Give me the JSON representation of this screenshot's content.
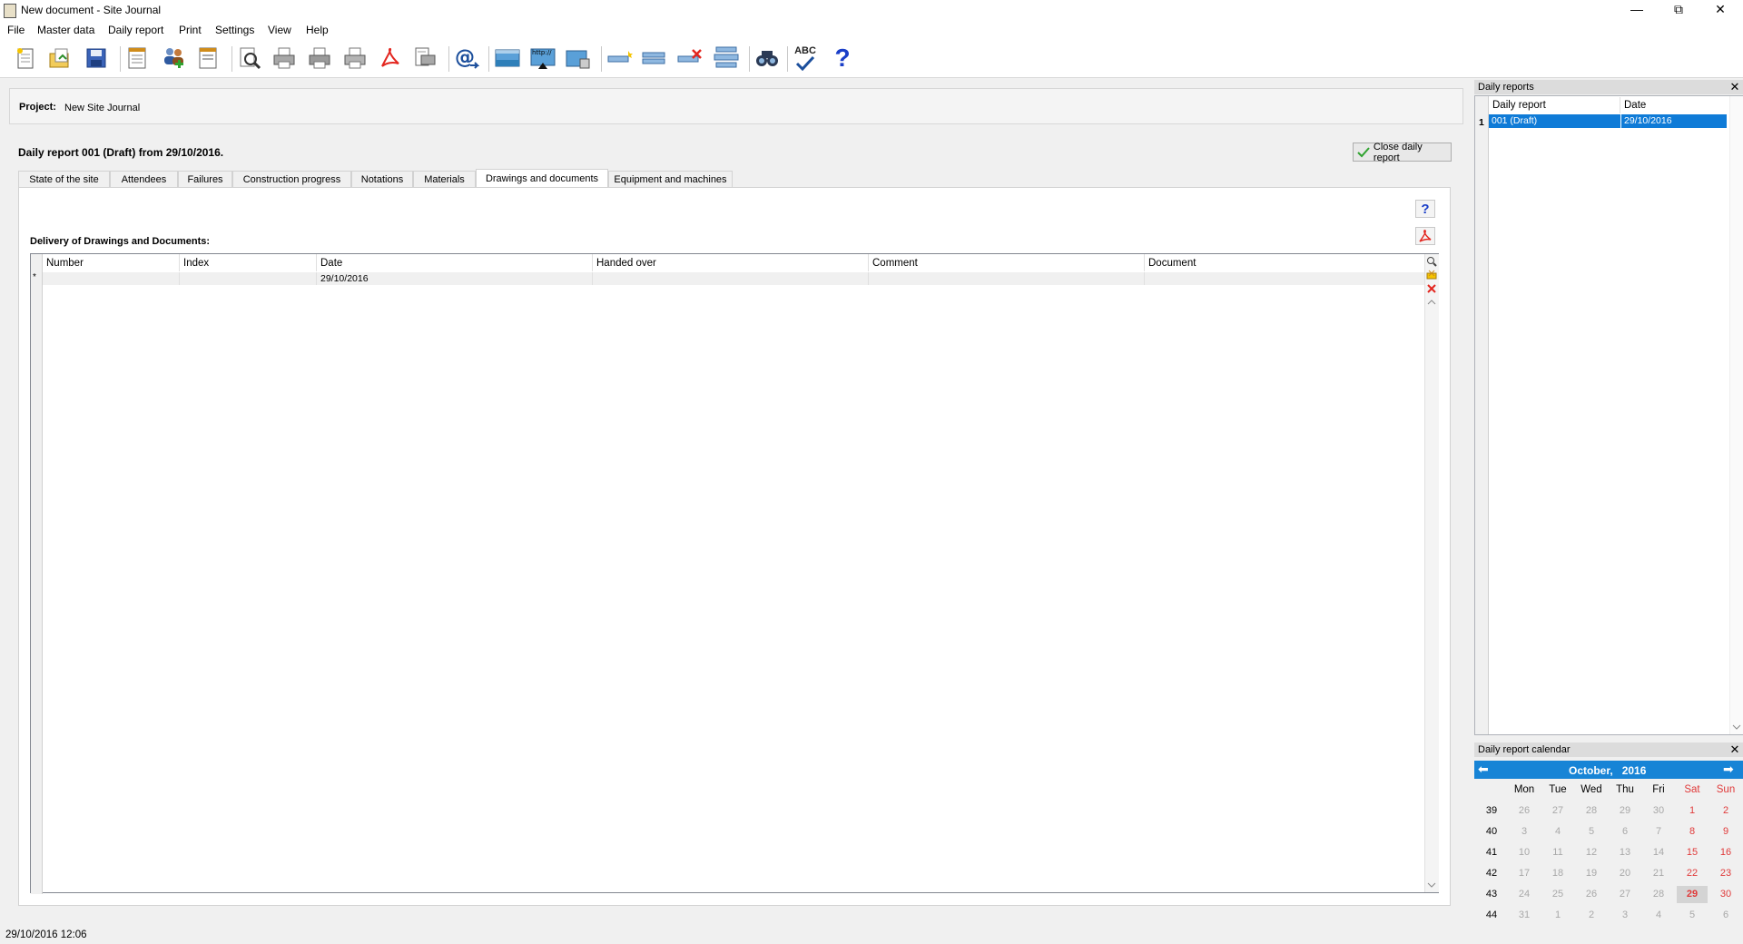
{
  "window": {
    "title": "New document - Site Journal",
    "minimize": "—",
    "maximize": "⧉",
    "close": "✕"
  },
  "menu": [
    "File",
    "Master data",
    "Daily report",
    "Print",
    "Settings",
    "View",
    "Help"
  ],
  "toolbar": {
    "buttons": [
      "new-document",
      "open-document",
      "save",
      "report-list",
      "master-data-people",
      "page-setup",
      "print-preview",
      "print",
      "print-all",
      "print-quick",
      "export-pdf",
      "export-document",
      "send-email",
      "image-insert",
      "image-web",
      "image-export",
      "add-entry",
      "insert-entry",
      "delete-entry",
      "move-entry",
      "find",
      "spellcheck",
      "help"
    ],
    "spellcheck_label": "ABC",
    "help_label": "?"
  },
  "project": {
    "label": "Project:",
    "value": "New Site Journal"
  },
  "report": {
    "heading": "Daily report 001 (Draft) from 29/10/2016.",
    "close_label": "Close daily report"
  },
  "tabs": [
    "State of the site",
    "Attendees",
    "Failures",
    "Construction progress",
    "Notations",
    "Materials",
    "Drawings and documents",
    "Equipment and machines"
  ],
  "active_tab": "Drawings and documents",
  "section": {
    "title": "Delivery of Drawings and Documents:",
    "help_label": "?",
    "columns": [
      "Number",
      "Index",
      "Date",
      "Handed over",
      "Comment",
      "Document"
    ],
    "new_row": {
      "marker": "*",
      "date": "29/10/2016"
    }
  },
  "daily_reports_panel": {
    "title": "Daily reports",
    "close": "✕",
    "columns": [
      "Daily report",
      "Date"
    ],
    "rows": [
      {
        "index": "1",
        "report": "001 (Draft)",
        "date": "29/10/2016"
      }
    ]
  },
  "calendar_panel": {
    "title": "Daily report calendar",
    "close": "✕",
    "prev": "⬅",
    "next": "➡",
    "month": "October,",
    "year": "2016",
    "days_of_week": [
      "Mon",
      "Tue",
      "Wed",
      "Thu",
      "Fri",
      "Sat",
      "Sun"
    ],
    "weeks": [
      {
        "week": "39",
        "days": [
          "26",
          "27",
          "28",
          "29",
          "30",
          "1",
          "2"
        ]
      },
      {
        "week": "40",
        "days": [
          "3",
          "4",
          "5",
          "6",
          "7",
          "8",
          "9"
        ]
      },
      {
        "week": "41",
        "days": [
          "10",
          "11",
          "12",
          "13",
          "14",
          "15",
          "16"
        ]
      },
      {
        "week": "42",
        "days": [
          "17",
          "18",
          "19",
          "20",
          "21",
          "22",
          "23"
        ]
      },
      {
        "week": "43",
        "days": [
          "24",
          "25",
          "26",
          "27",
          "28",
          "29",
          "30"
        ]
      },
      {
        "week": "44",
        "days": [
          "31",
          "1",
          "2",
          "3",
          "4",
          "5",
          "6"
        ]
      }
    ],
    "selected_day": "29",
    "colors": {
      "header": "#1784d6",
      "weekend": "#e03a3a",
      "other_day": "#a8a8a8",
      "selected_bg": "#d4d4d4"
    }
  },
  "status": {
    "datetime": "29/10/2016 12:06"
  }
}
